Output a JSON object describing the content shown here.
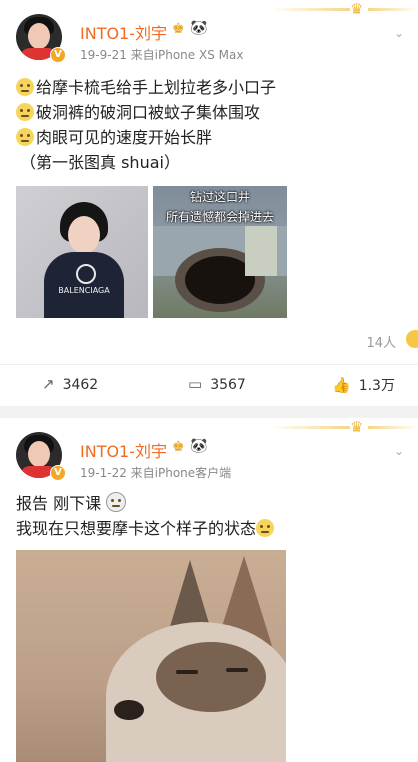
{
  "post1": {
    "username": "INTO1-刘宇",
    "member_icon": "vip-crown-icon",
    "panda_emoji": "🐼",
    "meta": "19-9-21  来自iPhone XS Max",
    "lines": [
      "给摩卡梳毛给手上划拉老多小口子",
      "破洞裤的破洞口被蚊子集体围攻",
      "肉眼可见的速度开始长胖",
      "（第一张图真 shuai）"
    ],
    "image1": {
      "hoodie_text": "BALENCIAGA"
    },
    "image2": {
      "caption_line1": "钻过这口井",
      "caption_line2": "所有遗憾都会掉进去"
    },
    "reaction_count": "14人",
    "actions": {
      "repost": "3462",
      "comment": "3567",
      "like": "1.3万"
    }
  },
  "post2": {
    "username": "INTO1-刘宇",
    "member_icon": "vip-crown-icon",
    "panda_emoji": "🐼",
    "meta": "19-1-22  来自iPhone客户端",
    "lines": [
      "报告 刚下课",
      "我现在只想要摩卡这个样子的状态"
    ]
  },
  "colors": {
    "username": "#f26b21",
    "meta": "#888888",
    "background": "#f2f2f2",
    "badge": "#f5a623"
  }
}
